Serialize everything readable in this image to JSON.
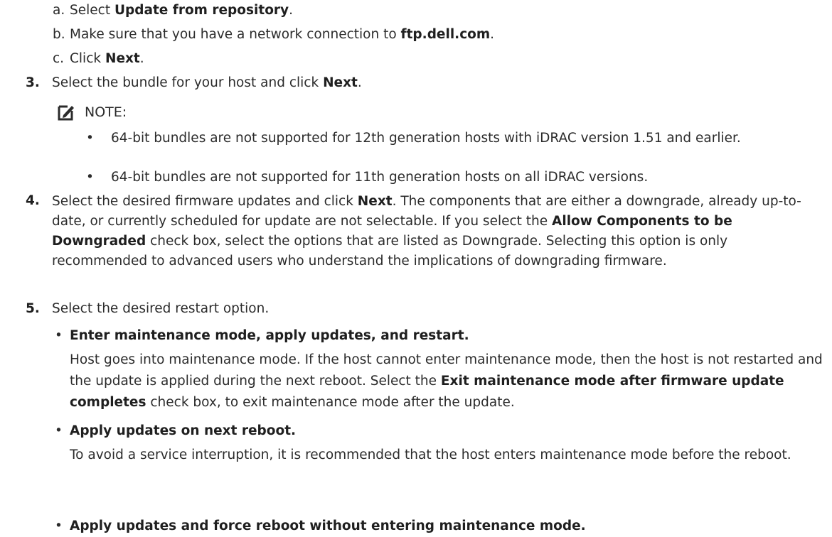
{
  "step2_substeps": [
    {
      "marker": "a.",
      "pre": "Select ",
      "bold": "Update from repository",
      "post": "."
    },
    {
      "marker": "b.",
      "pre": "Make sure that you have a network connection to ",
      "bold": "ftp.dell.com",
      "post": "."
    },
    {
      "marker": "c.",
      "pre": "Click ",
      "bold": "Next",
      "post": "."
    }
  ],
  "step3": {
    "number": "3.",
    "pre": "Select the bundle for your host and click ",
    "bold": "Next",
    "post": "."
  },
  "note": {
    "label": "NOTE:",
    "icon": "pencil-note-icon",
    "items": [
      "64-bit bundles are not supported for 12th generation hosts with iDRAC version 1.51 and earlier.",
      "64-bit bundles are not supported for 11th generation hosts on all iDRAC versions."
    ]
  },
  "step4": {
    "number": "4.",
    "t1": "Select the desired firmware updates and click ",
    "b1": "Next",
    "t2": ". The components that are either a downgrade, already up-to-date, or currently scheduled for update are not selectable. If you select the ",
    "b2": "Allow Components to be Downgraded",
    "t3": " check box, select the options that are listed as Downgrade. Selecting this option is only recommended to advanced users who understand the implications of downgrading firmware."
  },
  "step5": {
    "number": "5.",
    "text": "Select the desired restart option.",
    "options": [
      {
        "title": "Enter maintenance mode, apply updates, and restart.",
        "d1": "Host goes into maintenance mode. If the host cannot enter maintenance mode, then the host is not restarted and the update is applied during the next reboot. Select the ",
        "b1": "Exit maintenance mode after firmware update completes",
        "d2": " check box, to exit maintenance mode after the update."
      },
      {
        "title": "Apply updates on next reboot.",
        "d1": "To avoid a service interruption, it is recommended that the host enters maintenance mode before the reboot."
      },
      {
        "title": "Apply updates and force reboot without entering maintenance mode."
      }
    ]
  },
  "bullet_char": "•"
}
